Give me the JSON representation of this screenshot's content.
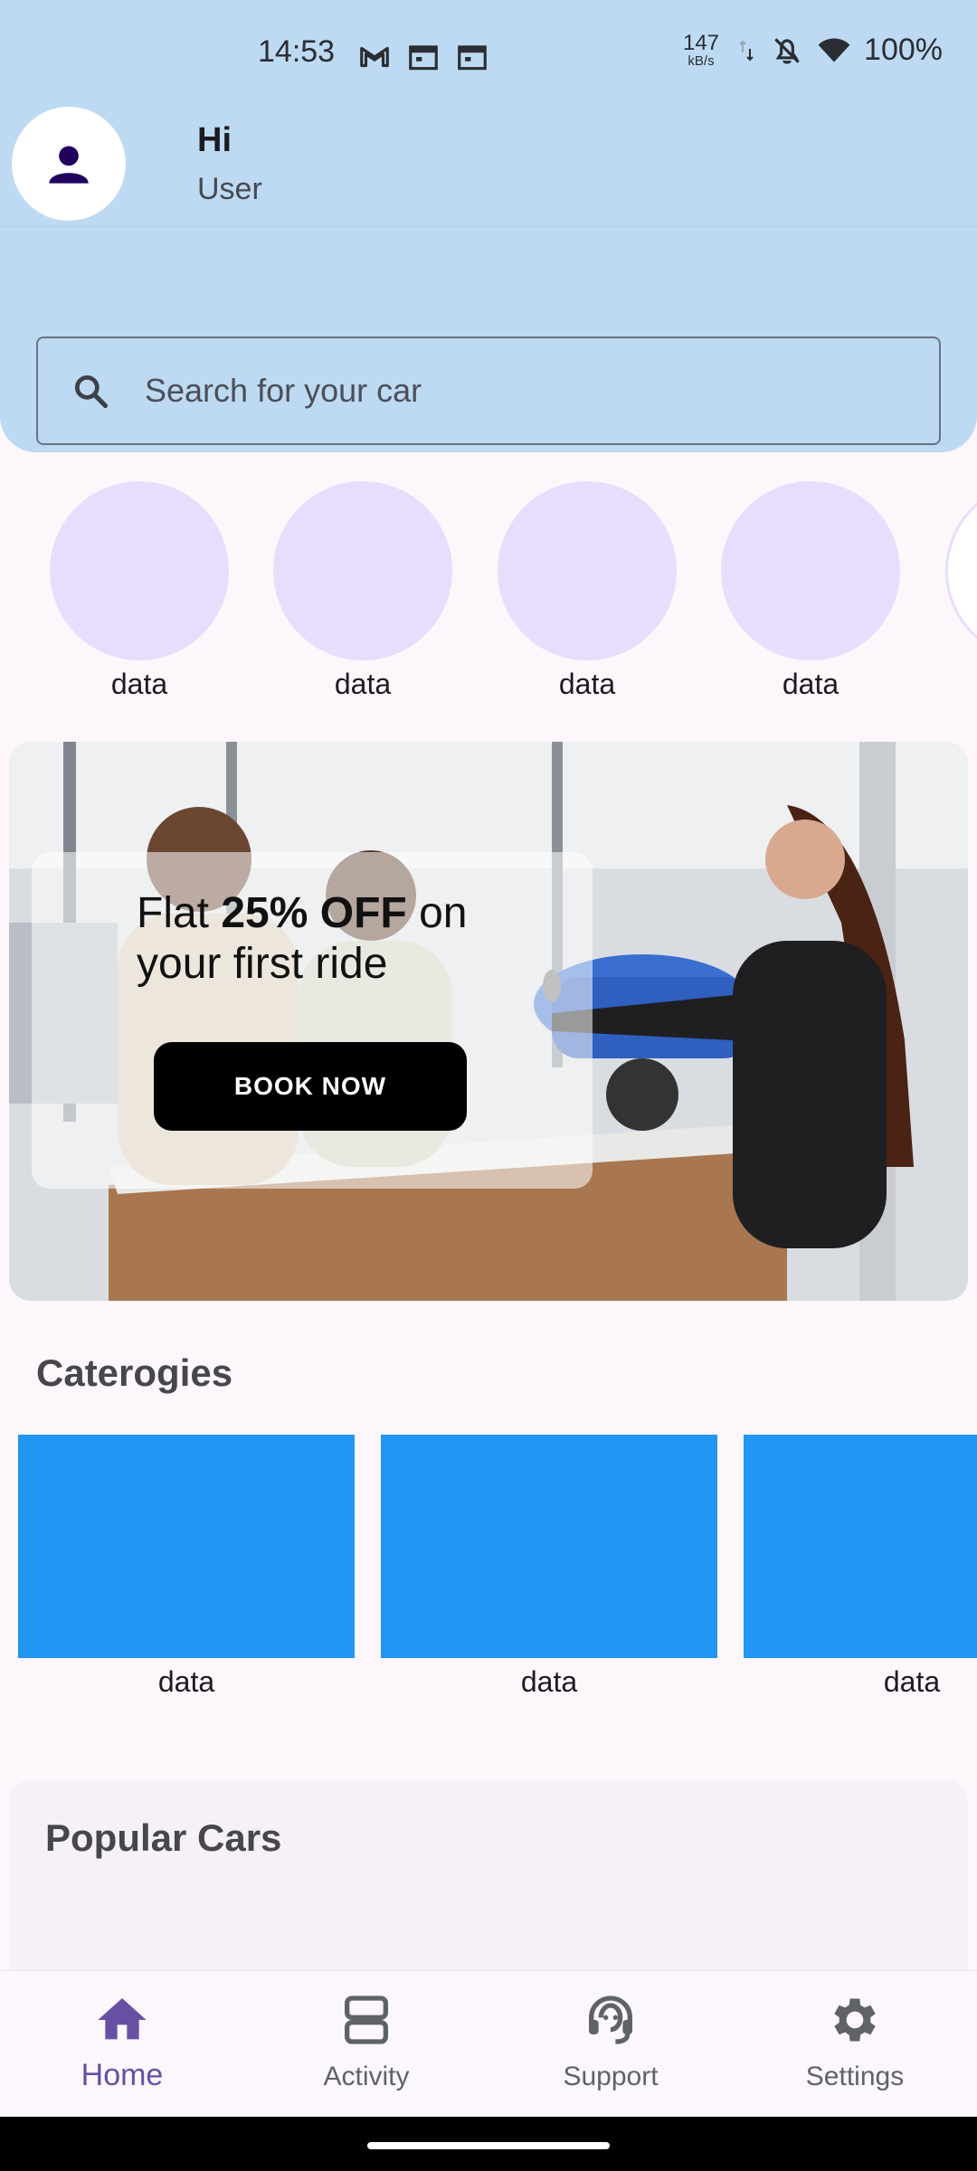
{
  "status_bar": {
    "time": "14:53",
    "net_speed_value": "147",
    "net_speed_unit": "kB/s",
    "battery": "100%",
    "icons": [
      "gmail-icon",
      "calendar-icon",
      "calendar-icon",
      "data-arrows-icon",
      "bell-off-icon",
      "wifi-icon"
    ]
  },
  "header": {
    "greeting": "Hi",
    "username": "User",
    "avatar_icon": "person-icon",
    "background_color": "#BEDAF3"
  },
  "search": {
    "placeholder": "Search for your car",
    "icon": "search-icon"
  },
  "circle_categories": [
    {
      "label": "data"
    },
    {
      "label": "data"
    },
    {
      "label": "data"
    },
    {
      "label": "data"
    }
  ],
  "promo": {
    "text_prefix": "Flat ",
    "text_bold": "25% OFF",
    "text_suffix": " on your first ride",
    "button_label": "BOOK NOW"
  },
  "categories": {
    "title": "Caterogies",
    "items": [
      {
        "label": "data"
      },
      {
        "label": "data"
      },
      {
        "label": "data"
      }
    ],
    "tile_color": "#2196F3"
  },
  "popular": {
    "title": "Popular Cars"
  },
  "bottom_nav": {
    "items": [
      {
        "label": "Home",
        "icon": "home-icon",
        "active": true
      },
      {
        "label": "Activity",
        "icon": "activity-icon",
        "active": false
      },
      {
        "label": "Support",
        "icon": "support-icon",
        "active": false
      },
      {
        "label": "Settings",
        "icon": "settings-icon",
        "active": false
      }
    ],
    "active_color": "#6750A4"
  }
}
